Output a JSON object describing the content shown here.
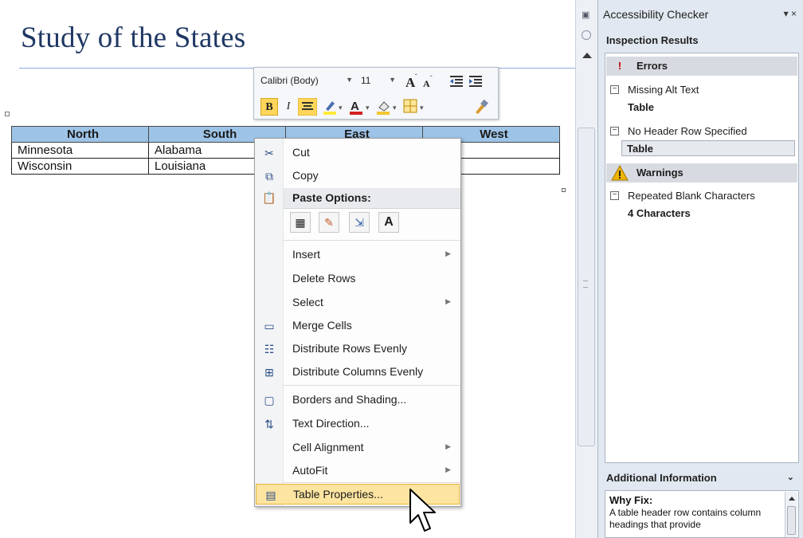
{
  "document": {
    "title": "Study of the States",
    "table": {
      "headers": [
        "North",
        "South",
        "East",
        "West"
      ],
      "rows": [
        [
          "Minnesota",
          "Alabama",
          "",
          "ornia"
        ],
        [
          "Wisconsin",
          "Louisiana",
          "",
          "ada"
        ]
      ]
    }
  },
  "mini_toolbar": {
    "font_name": "Calibri (Body)",
    "font_size": "11",
    "bold_label": "B",
    "italic_label": "I"
  },
  "context_menu": {
    "items": [
      {
        "label": "Cut",
        "icon": "scissors-icon"
      },
      {
        "label": "Copy",
        "icon": "copy-icon"
      },
      {
        "label": "Paste Options:",
        "icon": "paste-icon"
      },
      {
        "label": "Insert",
        "has_submenu": true
      },
      {
        "label": "Delete Rows"
      },
      {
        "label": "Select",
        "has_submenu": true
      },
      {
        "label": "Merge Cells",
        "icon": "merge-cells-icon"
      },
      {
        "label": "Distribute Rows Evenly",
        "icon": "distribute-rows-icon"
      },
      {
        "label": "Distribute Columns Evenly",
        "icon": "distribute-columns-icon"
      },
      {
        "label": "Borders and Shading...",
        "icon": "borders-icon"
      },
      {
        "label": "Text Direction...",
        "icon": "text-direction-icon"
      },
      {
        "label": "Cell Alignment",
        "has_submenu": true
      },
      {
        "label": "AutoFit",
        "has_submenu": true
      },
      {
        "label": "Table Properties...",
        "icon": "table-properties-icon",
        "highlighted": true
      }
    ],
    "paste_letter": "A"
  },
  "pane": {
    "title": "Accessibility Checker",
    "close": "▾ ×",
    "subtitle": "Inspection Results",
    "errors_label": "Errors",
    "error1_title": "Missing Alt Text",
    "error1_child": "Table",
    "error2_title": "No Header Row Specified",
    "error2_child": "Table",
    "warnings_label": "Warnings",
    "warning1_title": "Repeated Blank Characters",
    "warning1_child": "4 Characters",
    "additional_label": "Additional Information",
    "why_fix": "Why Fix:",
    "why_text": "A table header row contains column headings that provide"
  },
  "colors": {
    "title": "#1f3864",
    "table_header": "#9dc3e6",
    "highlight": "#fde4a0",
    "errors_icon": "#c00000",
    "warnings_icon": "#f0b400"
  }
}
